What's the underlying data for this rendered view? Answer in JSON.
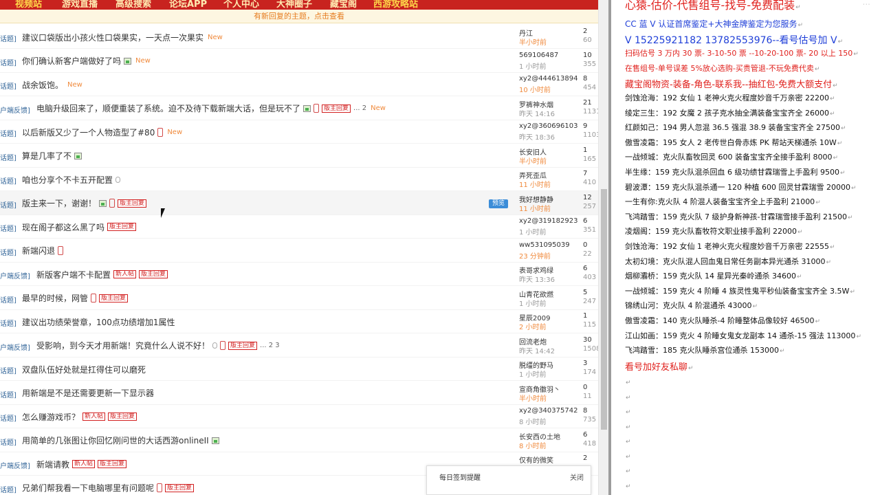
{
  "colors": {
    "nav_bg": "#c8231f",
    "link_blue": "#336699",
    "new_orange": "#f08a3c",
    "badge_red": "#d21f1f",
    "doc_red": "#e0201c",
    "doc_blue": "#1f3fd8",
    "preview_blue": "#3c8dd8"
  },
  "nav": {
    "items": [
      "视频站",
      "游戏直播",
      "高级搜索",
      "论坛APP",
      "个人中心",
      "大神圈子",
      "藏宝阁",
      "西游攻略站"
    ]
  },
  "notice": "有新回复的主题，点击查看",
  "threads": [
    {
      "cat": "话题]",
      "title": "建议口袋版出小孩火性口袋果实，一天点一次果实",
      "icons": [],
      "badges": [],
      "pages": "",
      "new": "New",
      "author": "丹江",
      "time": "半小时前",
      "time_red": true,
      "replies": "2",
      "views": "60"
    },
    {
      "cat": "话题]",
      "title": "你们确认新客户端做好了吗",
      "icons": [
        "image-icon"
      ],
      "badges": [],
      "pages": "",
      "new": "New",
      "author": "569106487",
      "time": "1 小时前",
      "time_red": false,
      "replies": "10",
      "views": "355"
    },
    {
      "cat": "话题]",
      "title": "战余饭饱。",
      "icons": [],
      "badges": [],
      "pages": "",
      "new": "New",
      "author": "xy2@444613894",
      "time": "10 小时前",
      "time_red": true,
      "replies": "8",
      "views": "454"
    },
    {
      "cat": "户端反馈]",
      "title": "电脑升级回来了，顺便重装了系统。迫不及待下载新端大话，但是玩不了",
      "icons": [
        "image-icon",
        "phone-icon"
      ],
      "badges": [
        "版主回复"
      ],
      "pages": "... 2",
      "new": "New",
      "author": "罗裤神水烟",
      "time": "昨天 14:16",
      "time_red": false,
      "replies": "21",
      "views": "1131"
    },
    {
      "cat": "话题]",
      "title": "以后新版又少了一个人物造型了#80",
      "icons": [
        "phone-icon"
      ],
      "badges": [],
      "pages": "",
      "new": "New",
      "author": "xy2@360696103",
      "time": "昨天 18:36",
      "time_red": false,
      "replies": "9",
      "views": "1103"
    },
    {
      "cat": "话题]",
      "title": "算是几率了不",
      "icons": [
        "image-icon"
      ],
      "badges": [],
      "pages": "",
      "new": "",
      "author": "长安旧人",
      "time": "半小时前",
      "time_red": true,
      "replies": "1",
      "views": "165"
    },
    {
      "cat": "话题]",
      "title": "咱也分享个不卡五开配置",
      "icons": [
        "clip-icon"
      ],
      "badges": [],
      "pages": "",
      "new": "",
      "author": "弄死歪瓜",
      "time": "11 小时前",
      "time_red": true,
      "replies": "7",
      "views": "410"
    },
    {
      "cat": "话题]",
      "title": "版主来一下，谢谢！",
      "icons": [
        "image-icon",
        "phone-icon"
      ],
      "badges": [
        "版主回复"
      ],
      "pages": "",
      "new": "",
      "author": "我好想静静",
      "time": "11 小时前",
      "time_red": true,
      "replies": "12",
      "views": "257",
      "preview": "预览",
      "hover": true
    },
    {
      "cat": "话题]",
      "title": "现在阁子都这么黑了吗",
      "icons": [],
      "badges": [
        "版主回复"
      ],
      "pages": "",
      "new": "",
      "author": "xy2@319182923",
      "time": "1 小时前",
      "time_red": false,
      "replies": "6",
      "views": "351"
    },
    {
      "cat": "话题]",
      "title": "新端闪退",
      "icons": [
        "phone-icon"
      ],
      "badges": [],
      "pages": "",
      "new": "",
      "author": "ww531095039",
      "time": "23 分钟前",
      "time_red": true,
      "replies": "0",
      "views": "22"
    },
    {
      "cat": "户端反馈]",
      "title": "新版客户端不卡配置",
      "icons": [],
      "badges": [
        "新人帖",
        "版主回复"
      ],
      "pages": "",
      "new": "",
      "author": "表哥求鸡绿",
      "time": "昨天 13:36",
      "time_red": false,
      "replies": "6",
      "views": "403"
    },
    {
      "cat": "话题]",
      "title": "最早的时候，网管",
      "icons": [
        "phone-icon"
      ],
      "badges": [
        "版主回复"
      ],
      "pages": "",
      "new": "",
      "author": "山青花欲燃",
      "time": "1 小时前",
      "time_red": false,
      "replies": "5",
      "views": "247"
    },
    {
      "cat": "话题]",
      "title": "建议出功绩荣誉章，100点功绩增加1属性",
      "icons": [],
      "badges": [],
      "pages": "",
      "new": "",
      "author": "星辰2009",
      "time": "2 小时前",
      "time_red": true,
      "replies": "1",
      "views": "115"
    },
    {
      "cat": "户端反馈]",
      "title": "受影响，到今天才用新端！究竟什么人说不好！",
      "icons": [
        "clip-icon",
        "phone-icon"
      ],
      "badges": [
        "版主回复"
      ],
      "pages": "... 2  3",
      "new": "",
      "author": "回流老炮",
      "time": "昨天 14:42",
      "time_red": false,
      "replies": "30",
      "views": "1508"
    },
    {
      "cat": "话题]",
      "title": "双盘队伍好处就是扛得住可以磨死",
      "icons": [],
      "badges": [],
      "pages": "",
      "new": "",
      "author": "脱缰的野马",
      "time": "1 小时前",
      "time_red": false,
      "replies": "3",
      "views": "174"
    },
    {
      "cat": "话题]",
      "title": "用新端是不是还需要更新一下显示器",
      "icons": [],
      "badges": [],
      "pages": "",
      "new": "",
      "author": "宣商角徽羽丶",
      "time": "半小时前",
      "time_red": true,
      "replies": "0",
      "views": "11"
    },
    {
      "cat": "话题]",
      "title": "怎么赚游戏币？",
      "icons": [],
      "badges": [
        "新人帖",
        "版主回复"
      ],
      "pages": "",
      "new": "",
      "author": "xy2@340375742",
      "time": "8 小时前",
      "time_red": false,
      "replies": "8",
      "views": "735"
    },
    {
      "cat": "话题]",
      "title": "用简单的几张图让你回忆刚问世的大话西游onlineII",
      "icons": [
        "image-icon"
      ],
      "badges": [],
      "pages": "",
      "new": "",
      "author": "长安西の土地",
      "time": "8 小时前",
      "time_red": true,
      "replies": "6",
      "views": "418"
    },
    {
      "cat": "户端反馈]",
      "title": "新端请教",
      "icons": [],
      "badges": [
        "新人帖",
        "版主回复"
      ],
      "pages": "",
      "new": "",
      "author": "仅有的微笑",
      "time": "",
      "time_red": false,
      "replies": "2",
      "views": ""
    },
    {
      "cat": "话题]",
      "title": "兄弟们帮我看一下电脑哪里有问题呢",
      "icons": [
        "phone-icon"
      ],
      "badges": [
        "版主回复"
      ],
      "pages": "",
      "new": "",
      "author": "",
      "time": "",
      "time_red": false,
      "replies": "",
      "views": ""
    }
  ],
  "signin_popup": {
    "title": "每日签到提醒",
    "close": "关闭"
  },
  "doc": {
    "watermark": "...",
    "lines": [
      {
        "text": "心猿-估价-代售组号-找号-免费配装",
        "color": "#e0201c",
        "size": 16
      },
      {
        "text": "CC 蓝 V 认证首席鉴定+大神金牌鉴定为您服务",
        "color": "#1f3fd8",
        "size": 12
      },
      {
        "text": "V 15225921182     13782553976--看号估号加 V",
        "color": "#1f3fd8",
        "size": 14
      },
      {
        "text": "扫码估号 3 万内 30 票- 3-10-50 票  --10-20-100 票- 20 以上 150",
        "color": "#e0201c",
        "size": 11
      },
      {
        "text": "在售组号-单号误差 5%放心选购-买贵管退-不玩免费代卖",
        "color": "#e0201c",
        "size": 11
      },
      {
        "text": "藏宝阁物资-装备-角色-联系我--抽红包-免费大额支付",
        "color": "#e0201c",
        "size": 13
      },
      {
        "text": "剑蚀沧海：192 女仙 1 老神火克火程度妙音千万亲密 22200",
        "color": "#111",
        "size": 11
      },
      {
        "text": "绫定三生：192 女魔 2 孩子克水抽全满装备宝宝齐全 26000",
        "color": "#111",
        "size": 11
      },
      {
        "text": "红颜如己：194 男人忽混 36.5 强混 38.9 装备宝宝齐全 27500",
        "color": "#111",
        "size": 11
      },
      {
        "text": "傲雪凌霜：195 女人 2 老传世白骨赤炼 PK 帮站天梯通杀 10W",
        "color": "#111",
        "size": 11
      },
      {
        "text": "一战倾城：克火队畜牧回灵 600 装备宝宝齐全接手盈利 8000",
        "color": "#111",
        "size": 11
      },
      {
        "text": "半生缘：159 克火队混杀回血 6 级功绩甘霖瑞雪上手盈利 9500",
        "color": "#111",
        "size": 11
      },
      {
        "text": "碧波潭：159 克火队混杀通一 120 种植 600 回灵甘霖瑞雪 20000",
        "color": "#111",
        "size": 11
      },
      {
        "text": "一生有你:克火队 4 阶混人装备宝宝齐全上手盈利 21000",
        "color": "#111",
        "size": 11
      },
      {
        "text": "飞鸿踏雪：159 克火队 7 级护身新神孩-甘霖瑞雪接手盈利 21500",
        "color": "#111",
        "size": 11
      },
      {
        "text": "凌烟阁：159 克火队畜牧符文职业接手盈利 22000",
        "color": "#111",
        "size": 11
      },
      {
        "text": "剑蚀沧海：192 女仙 1 老神火克火程度妙音千万亲密 22555",
        "color": "#111",
        "size": 11
      },
      {
        "text": "太初幻境：克火队混人回血鬼日常任务副本异光通杀 31000",
        "color": "#111",
        "size": 11
      },
      {
        "text": "烟柳灞桥：159 克火队 14 星异光秦岭通杀 34600",
        "color": "#111",
        "size": 11
      },
      {
        "text": "一战倾城：159 克火 4 阶睡 4 族灵性鬼平秒仙装备宝宝齐全 3.5W",
        "color": "#111",
        "size": 11
      },
      {
        "text": "锦绣山河：克火队 4 阶混通杀 43000",
        "color": "#111",
        "size": 11
      },
      {
        "text": "傲雪凌霜：140 克火队睡杀-4 阶睡整体品像较好 46500",
        "color": "#111",
        "size": 11
      },
      {
        "text": "江山如画：159 克火 4 阶睡女鬼女龙副本 14 通杀-15 强法 113000",
        "color": "#111",
        "size": 11
      },
      {
        "text": "飞鸿踏雪：185 克火队睡杀宫位通杀 153000",
        "color": "#111",
        "size": 11
      },
      {
        "text": "看号加好友私聊",
        "color": "#e0201c",
        "size": 13
      }
    ],
    "para_mark": "↵"
  }
}
